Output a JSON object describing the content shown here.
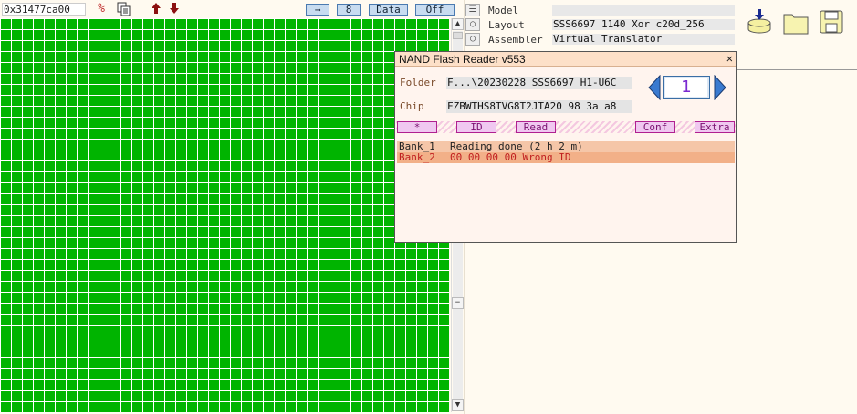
{
  "toolbar": {
    "address": "0x31477ca00",
    "goto_label": "→",
    "count_label": "8",
    "data_label": "Data",
    "off_label": "Off"
  },
  "info": {
    "model_label": "Model",
    "model_value": "",
    "layout_label": "Layout",
    "layout_value": "SSS6697 1140 Xor c20d_256",
    "assembler_label": "Assembler",
    "assembler_value": "Virtual Translator"
  },
  "nand": {
    "title": "NAND Flash Reader v553",
    "close": "✕",
    "folder_label": "Folder",
    "folder_value": "F...\\20230228_SSS6697 H1-U6C",
    "chip_label": "Chip",
    "chip_value": "FZBWTHS8TVG8T2JTA20  98 3a a8",
    "counter": "1",
    "buttons": [
      "*",
      "ID",
      "Read",
      "Conf",
      "Extra"
    ],
    "banks": [
      {
        "name": "Bank_1",
        "message": "Reading done (2 h 2 m)"
      },
      {
        "name": "Bank_2",
        "message": "00 00 00 00   Wrong ID"
      }
    ]
  },
  "colors": {
    "sector_ok": "#00b400",
    "panel_bg": "#fffaf0",
    "accent_blue": "#3a6ea5",
    "error_red": "#c02020"
  }
}
